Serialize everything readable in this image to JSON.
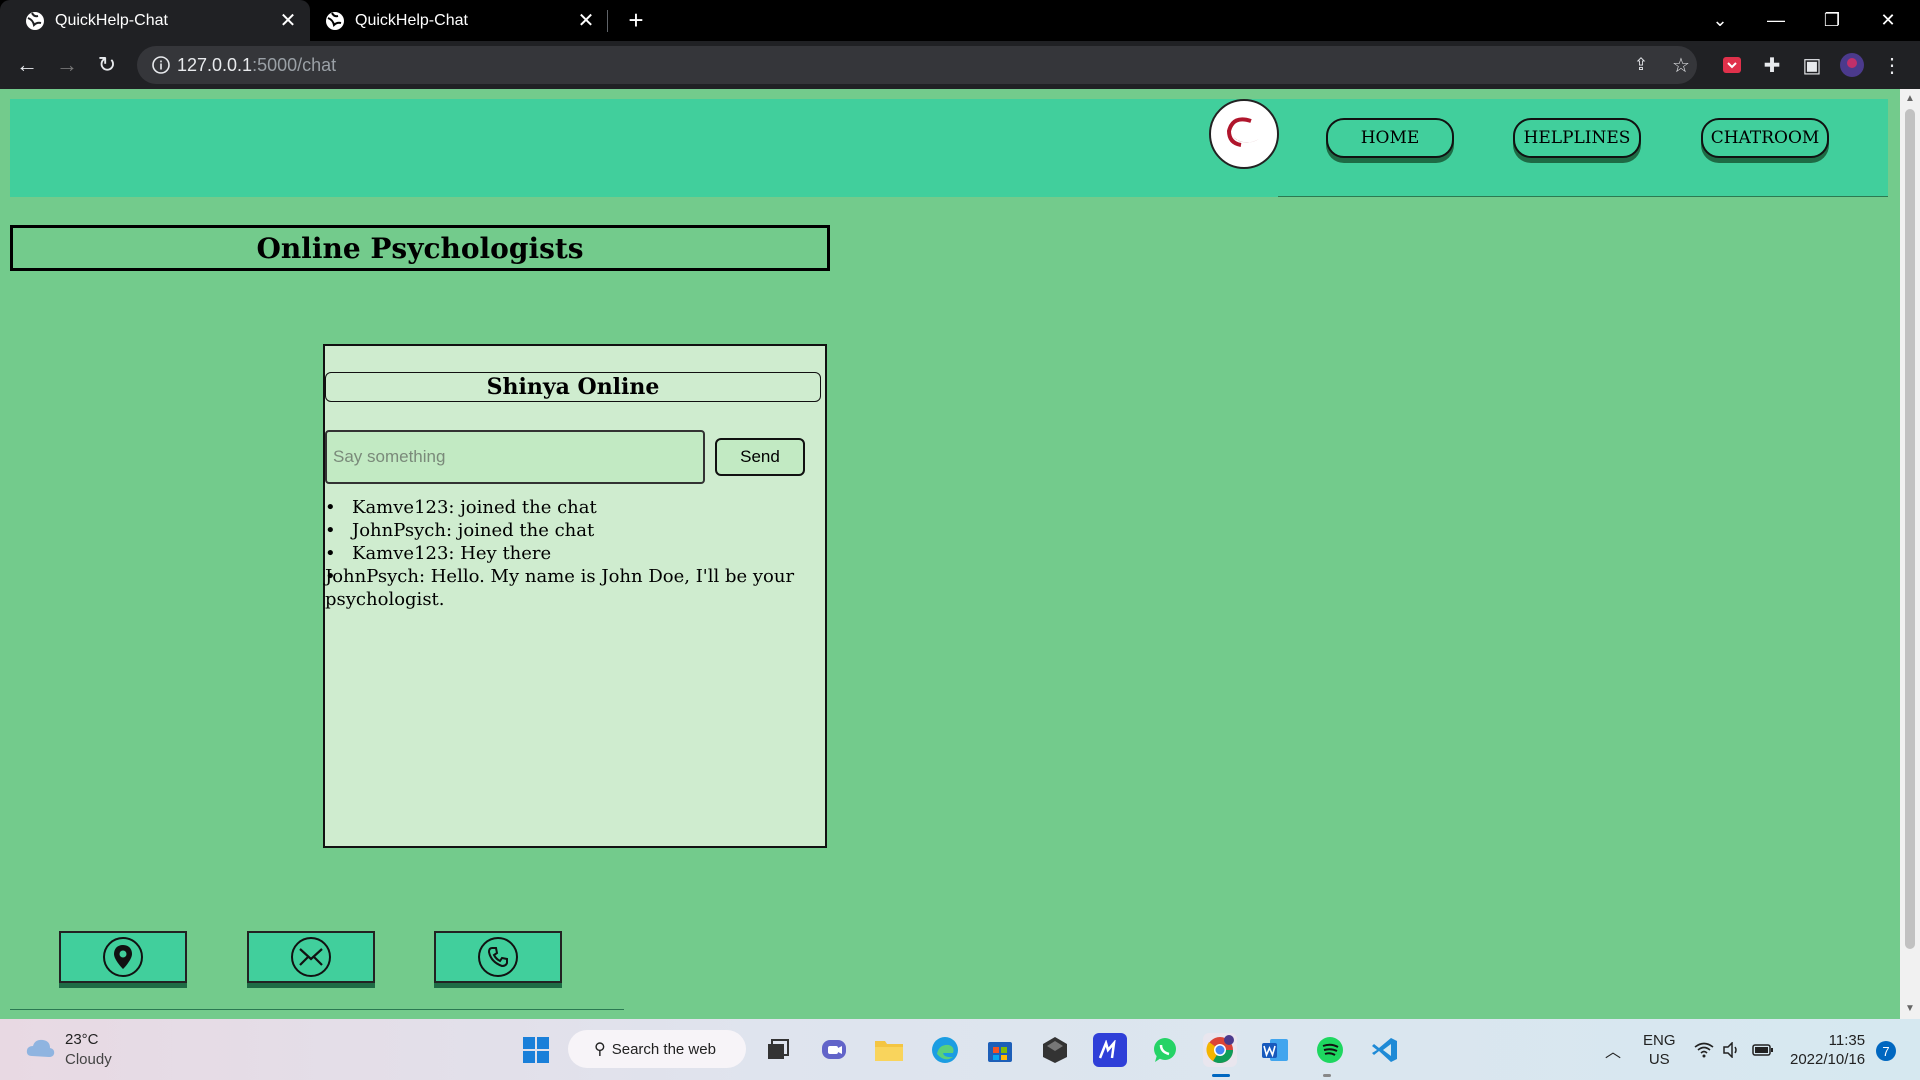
{
  "browser": {
    "tabs": [
      {
        "title": "QuickHelp-Chat",
        "close": "✕"
      },
      {
        "title": "QuickHelp-Chat",
        "close": "✕"
      }
    ],
    "new_tab": "+",
    "url_host": "127.0.0.1",
    "url_rest": ":5000/chat"
  },
  "nav": {
    "home": "HOME",
    "helplines": "HELPLINES",
    "chatroom": "CHATROOM"
  },
  "page": {
    "title": "Online Psychologists"
  },
  "chat": {
    "header": "Shinya Online",
    "input_placeholder": "Say something",
    "input_value": "",
    "send_label": "Send",
    "messages": [
      "Kamve123: joined the chat",
      "JohnPsych: joined the chat",
      "Kamve123: Hey there",
      "JohnPsych: Hello. My name is John Doe, I'll be your psychologist."
    ]
  },
  "footer": {
    "icons": [
      "location-pin",
      "mail",
      "phone"
    ]
  },
  "taskbar": {
    "weather_temp": "23°C",
    "weather_cond": "Cloudy",
    "search_label": "Search the web",
    "lang_top": "ENG",
    "lang_bottom": "US",
    "time": "11:35",
    "date": "2022/10/16",
    "notifications": "7"
  },
  "colors": {
    "page_bg": "#73cb8c",
    "header_bg": "#41cf9c",
    "chat_bg": "#cfeccf"
  }
}
